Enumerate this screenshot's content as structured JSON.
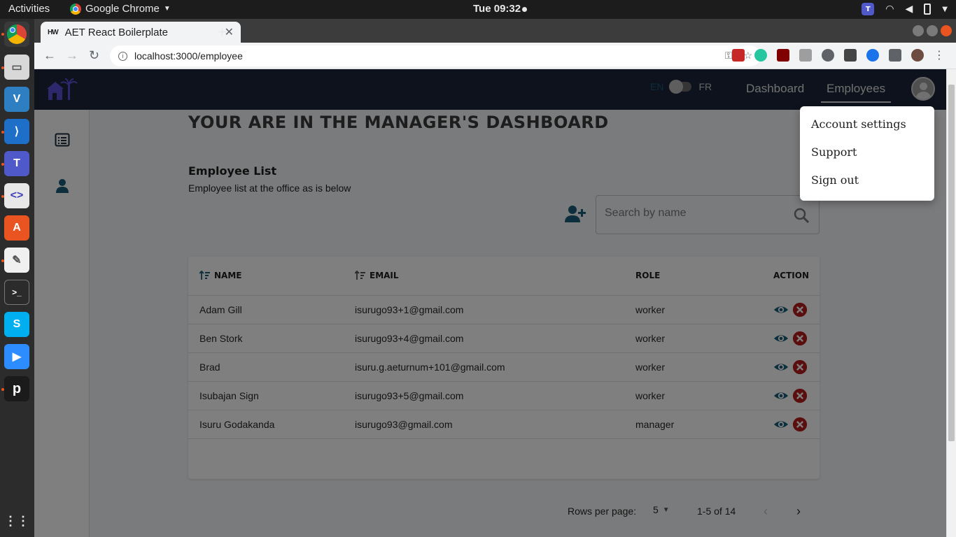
{
  "system": {
    "activities": "Activities",
    "app_name": "Google Chrome",
    "clock": "Tue 09:32"
  },
  "browser": {
    "tab_title": "AET React Boilerplate",
    "tab_favicon_text": "HW",
    "url": "localhost:3000/employee"
  },
  "header": {
    "lang_en": "EN",
    "lang_fr": "FR",
    "nav_dashboard": "Dashboard",
    "nav_employees": "Employees"
  },
  "main": {
    "title": "YOUR ARE IN THE MANAGER'S DASHBOARD",
    "list_title": "Employee List",
    "list_subtitle": "Employee list at the office as is below",
    "search_placeholder": "Search by name"
  },
  "table": {
    "columns": [
      "NAME",
      "EMAIL",
      "ROLE",
      "ACTION"
    ],
    "rows": [
      {
        "name": "Adam Gill",
        "email": "isurugo93+1@gmail.com",
        "role": "worker"
      },
      {
        "name": "Ben Stork",
        "email": "isurugo93+4@gmail.com",
        "role": "worker"
      },
      {
        "name": "Brad",
        "email": "isuru.g.aeturnum+101@gmail.com",
        "role": "worker"
      },
      {
        "name": "Isubajan Sign",
        "email": "isurugo93+5@gmail.com",
        "role": "worker"
      },
      {
        "name": "Isuru Godakanda",
        "email": "isurugo93@gmail.com",
        "role": "manager"
      }
    ]
  },
  "pagination": {
    "rows_per_page_label": "Rows per page:",
    "rows_per_page_value": "5",
    "range_text": "1-5 of 14"
  },
  "account_menu": {
    "items": [
      "Account settings",
      "Support",
      "Sign out"
    ]
  },
  "colors": {
    "appbar": "#1a2438",
    "accent_teal": "#1a5f7a",
    "delete_red": "#b71c1c",
    "brand_purple": "#5b4fd6"
  }
}
